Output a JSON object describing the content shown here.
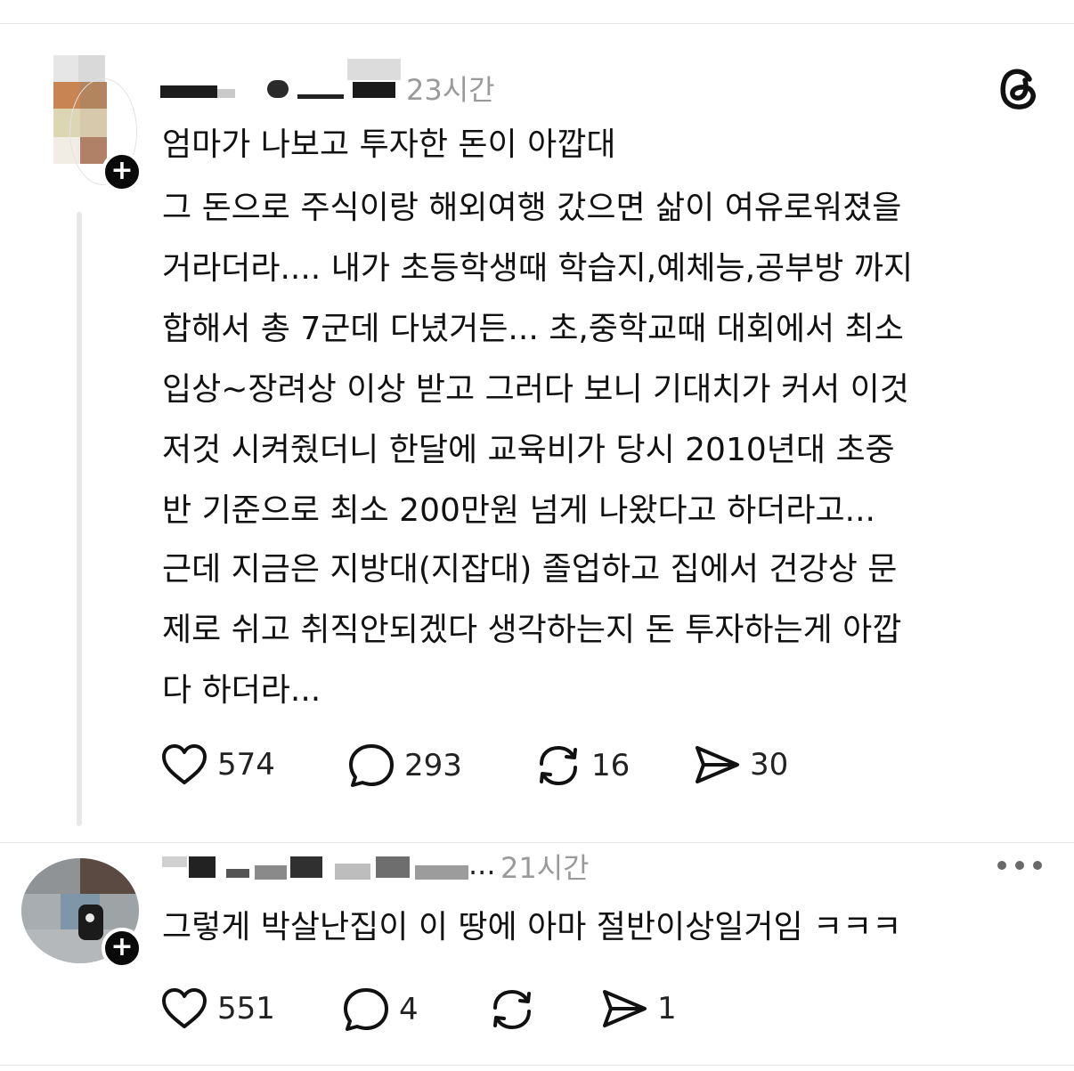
{
  "post1": {
    "timestamp": "23시간",
    "follow_symbol": "+",
    "headline": "엄마가 나보고 투자한 돈이 아깝대",
    "paragraph1": "그 돈으로 주식이랑 해외여행 갔으면 삶이 여유로워졌을\n거라더라.... 내가 초등학생때 학습지,예체능,공부방 까지\n합해서 총 7군데 다녔거든... 초,중학교때 대회에서 최소\n입상~장려상 이상 받고 그러다 보니 기대치가 커서 이것\n저것 시켜줬더니 한달에 교육비가 당시 2010년대 초중\n반 기준으로 최소 200만원 넘게 나왔다고 하더라고...",
    "paragraph2": "근데 지금은 지방대(지잡대) 졸업하고 집에서 건강상 문\n제로 쉬고 취직안되겠다 생각하는지 돈 투자하는게 아깝\n다 하더라...",
    "likes": "574",
    "replies": "293",
    "reposts": "16",
    "shares": "30"
  },
  "post2": {
    "username_suffix": "...",
    "timestamp": "21시간",
    "follow_symbol": "+",
    "text": "그렇게 박살난집이 이 땅에 아마 절반이상일거임 ㅋㅋㅋ",
    "likes": "551",
    "replies": "4",
    "reposts": "",
    "shares": "1"
  },
  "icons": {
    "threads_logo": "threads-logo-icon",
    "like": "heart-icon",
    "reply": "speech-bubble-icon",
    "repost": "repost-arrows-icon",
    "share": "paper-plane-icon",
    "more": "more-dots-icon",
    "follow": "plus-icon"
  },
  "colors": {
    "text": "#111111",
    "muted": "#9a9a9a",
    "divider": "#e6e6e6",
    "badge": "#0a0a0a"
  }
}
